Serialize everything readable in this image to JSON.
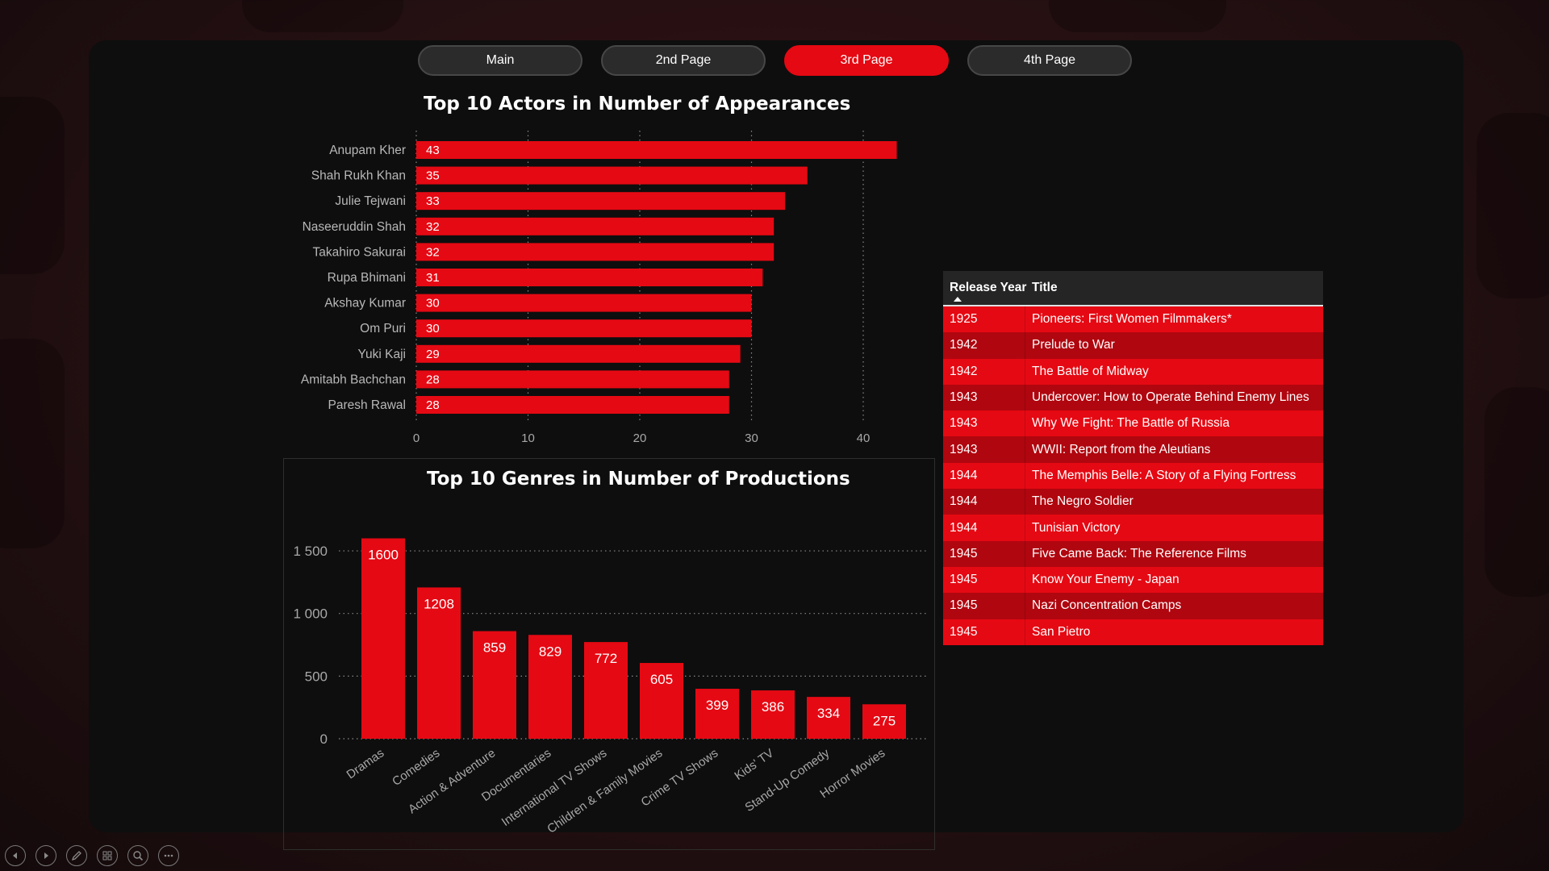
{
  "nav": {
    "items": [
      {
        "label": "Main",
        "active": false
      },
      {
        "label": "2nd Page",
        "active": false
      },
      {
        "label": "3rd Page",
        "active": true
      },
      {
        "label": "4th Page",
        "active": false
      }
    ]
  },
  "actors_chart": {
    "title": "Top 10 Actors in Number of Appearances"
  },
  "genres_chart": {
    "title": "Top 10 Genres in Number of Productions"
  },
  "table": {
    "headers": {
      "year": "Release Year",
      "title": "Title"
    },
    "rows": [
      {
        "year": "1925",
        "title": "Pioneers: First Women Filmmakers*"
      },
      {
        "year": "1942",
        "title": "Prelude to War"
      },
      {
        "year": "1942",
        "title": "The Battle of Midway"
      },
      {
        "year": "1943",
        "title": "Undercover: How to Operate Behind Enemy Lines"
      },
      {
        "year": "1943",
        "title": "Why We Fight: The Battle of Russia"
      },
      {
        "year": "1943",
        "title": "WWII: Report from the Aleutians"
      },
      {
        "year": "1944",
        "title": "The Memphis Belle: A Story of a Flying Fortress"
      },
      {
        "year": "1944",
        "title": "The Negro Soldier"
      },
      {
        "year": "1944",
        "title": "Tunisian Victory"
      },
      {
        "year": "1945",
        "title": "Five Came Back: The Reference Films"
      },
      {
        "year": "1945",
        "title": "Know Your Enemy - Japan"
      },
      {
        "year": "1945",
        "title": "Nazi Concentration Camps"
      },
      {
        "year": "1945",
        "title": "San Pietro"
      }
    ]
  },
  "controls": [
    "previous-icon",
    "next-icon",
    "pen-icon",
    "slides-icon",
    "zoom-icon",
    "more-icon"
  ],
  "colors": {
    "accent": "#e50913",
    "accent_dark": "#b0060f",
    "panel": "#0e0e0e"
  },
  "chart_data": [
    {
      "type": "bar",
      "orientation": "horizontal",
      "title": "Top 10 Actors in Number of Appearances",
      "categories": [
        "Anupam Kher",
        "Shah Rukh Khan",
        "Julie Tejwani",
        "Naseeruddin Shah",
        "Takahiro Sakurai",
        "Rupa Bhimani",
        "Akshay Kumar",
        "Om Puri",
        "Yuki Kaji",
        "Amitabh Bachchan",
        "Paresh Rawal"
      ],
      "values": [
        43,
        35,
        33,
        32,
        32,
        31,
        30,
        30,
        29,
        28,
        28
      ],
      "xlim": [
        0,
        45
      ],
      "xticks": [
        0,
        10,
        20,
        30,
        40
      ],
      "grid": true,
      "data_labels": true
    },
    {
      "type": "bar",
      "title": "Top 10 Genres in Number of Productions",
      "categories": [
        "Dramas",
        "Comedies",
        "Action & Adventure",
        "Documentaries",
        "International TV Shows",
        "Children & Family Movies",
        "Crime TV Shows",
        "Kids' TV",
        "Stand-Up Comedy",
        "Horror Movies"
      ],
      "values": [
        1600,
        1208,
        859,
        829,
        772,
        605,
        399,
        386,
        334,
        275
      ],
      "ylim": [
        0,
        1650
      ],
      "yticks": [
        0,
        500,
        1000,
        1500
      ],
      "ytick_labels": [
        "0",
        "500",
        "1 000",
        "1 500"
      ],
      "grid": true,
      "data_labels": true
    }
  ]
}
